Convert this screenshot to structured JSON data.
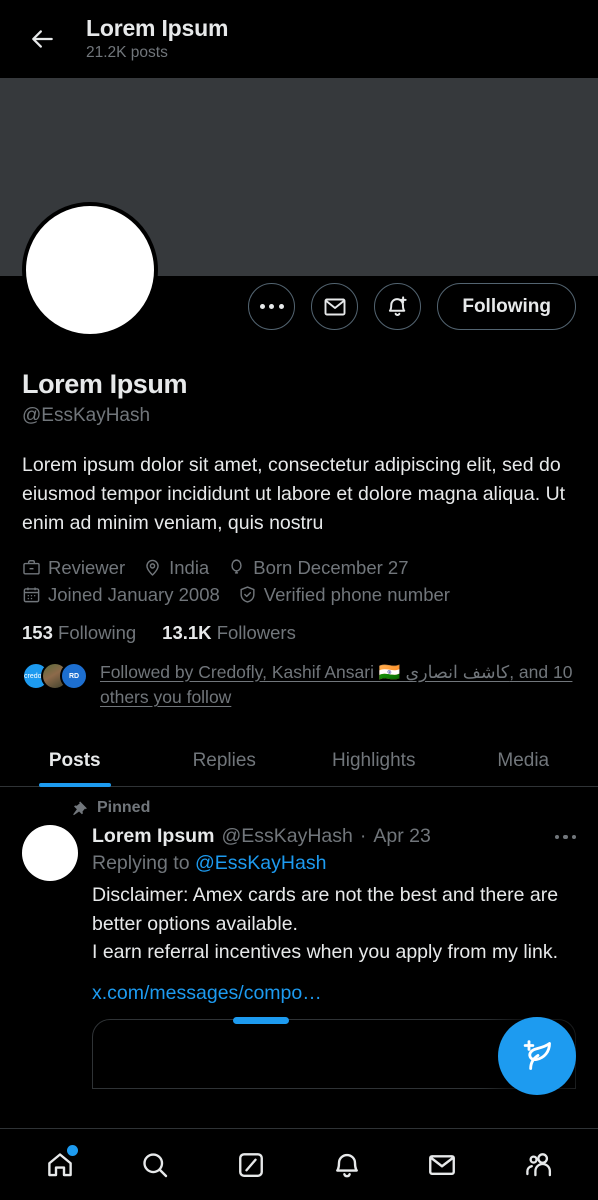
{
  "colors": {
    "background": "#000000",
    "accent": "#1d9bf0",
    "text_primary": "#e7e9ea",
    "text_secondary": "#71767b",
    "border": "#2f3336",
    "banner": "#36393c"
  },
  "topbar": {
    "back_icon": "back-arrow-icon",
    "title": "Lorem Ipsum",
    "posts_count": "21.2K posts"
  },
  "profile": {
    "banner_alt": "profile-banner",
    "avatar_alt": "profile-avatar",
    "actions": {
      "more_icon": "more-horizontal-icon",
      "message_icon": "envelope-icon",
      "notify_icon": "bell-plus-icon",
      "follow_label": "Following"
    },
    "display_name": "Lorem Ipsum",
    "handle": "@EssKayHash",
    "bio": "Lorem ipsum dolor sit amet, consectetur adipiscing elit, sed do eiusmod tempor incididunt ut labore et dolore magna aliqua. Ut enim ad minim veniam, quis nostru",
    "meta": [
      {
        "icon": "briefcase-icon",
        "label": "Reviewer"
      },
      {
        "icon": "location-pin-icon",
        "label": "India"
      },
      {
        "icon": "balloon-icon",
        "label": "Born December 27"
      },
      {
        "icon": "calendar-icon",
        "label": "Joined January 2008"
      },
      {
        "icon": "shield-check-icon",
        "label": "Verified phone number"
      }
    ],
    "following_count": "153",
    "following_label": "Following",
    "followers_count": "13.1K",
    "followers_label": "Followers",
    "followed_by": {
      "text": "Followed by Credofly, Kashif Ansari 🇮🇳 كاشف انصاری, and 10 others you follow",
      "avatars": [
        "credofly",
        "photo",
        "RD VEN"
      ]
    }
  },
  "tabs": [
    {
      "label": "Posts",
      "active": true
    },
    {
      "label": "Replies",
      "active": false
    },
    {
      "label": "Highlights",
      "active": false
    },
    {
      "label": "Media",
      "active": false
    }
  ],
  "pinned_post": {
    "pin_icon": "pin-icon",
    "pinned_label": "Pinned",
    "author_name": "Lorem Ipsum",
    "author_handle": "@EssKayHash",
    "separator": "·",
    "date": "Apr 23",
    "more_icon": "more-horizontal-icon",
    "replying_prefix": "Replying to ",
    "replying_to": "@EssKayHash",
    "text": "Disclaimer: Amex cards are not the best and there are better options available.\nI earn referral incentives when you apply from my link.",
    "link": "x.com/messages/compo…"
  },
  "compose_fab": {
    "icon": "compose-quill-plus-icon",
    "label": "Compose post"
  },
  "bottom_nav": [
    {
      "icon": "home-icon",
      "name": "nav-home",
      "badge": true
    },
    {
      "icon": "search-icon",
      "name": "nav-search",
      "badge": false
    },
    {
      "icon": "grok-icon",
      "name": "nav-grok",
      "badge": false
    },
    {
      "icon": "bell-icon",
      "name": "nav-notifications",
      "badge": false
    },
    {
      "icon": "envelope-icon",
      "name": "nav-messages",
      "badge": false
    },
    {
      "icon": "communities-icon",
      "name": "nav-communities",
      "badge": false
    }
  ]
}
